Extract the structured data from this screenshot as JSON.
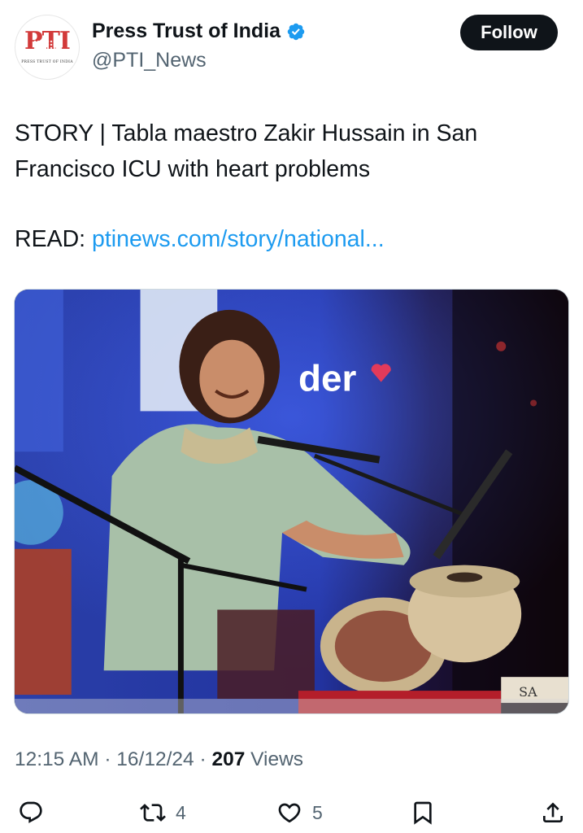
{
  "account": {
    "name": "Press Trust of India",
    "handle": "@PTI_News",
    "avatar_logo": "PTI",
    "avatar_subtitle": "PRESS TRUST OF INDIA",
    "verified_icon": "verified-badge-icon"
  },
  "follow_button": {
    "label": "Follow"
  },
  "tweet": {
    "line1": "STORY | Tabla maestro Zakir Hussain in San",
    "line2": "Francisco ICU with heart problems",
    "read_label": "READ: ",
    "link_text": "ptinews.com/story/national..."
  },
  "media": {
    "banner_text": "der",
    "drum_label": "SA"
  },
  "meta": {
    "time": "12:15 AM",
    "separator": " · ",
    "date": "16/12/24",
    "views_count": "207",
    "views_label": " Views"
  },
  "actions": {
    "reply": {
      "icon": "reply-icon"
    },
    "retweet": {
      "icon": "retweet-icon",
      "count": "4"
    },
    "like": {
      "icon": "heart-icon",
      "count": "5"
    },
    "bookmark": {
      "icon": "bookmark-icon"
    },
    "share": {
      "icon": "share-icon"
    }
  },
  "colors": {
    "link": "#1d9bf0",
    "verified": "#1d9bf0",
    "secondary_text": "#536471",
    "button_bg": "#0f1419"
  }
}
